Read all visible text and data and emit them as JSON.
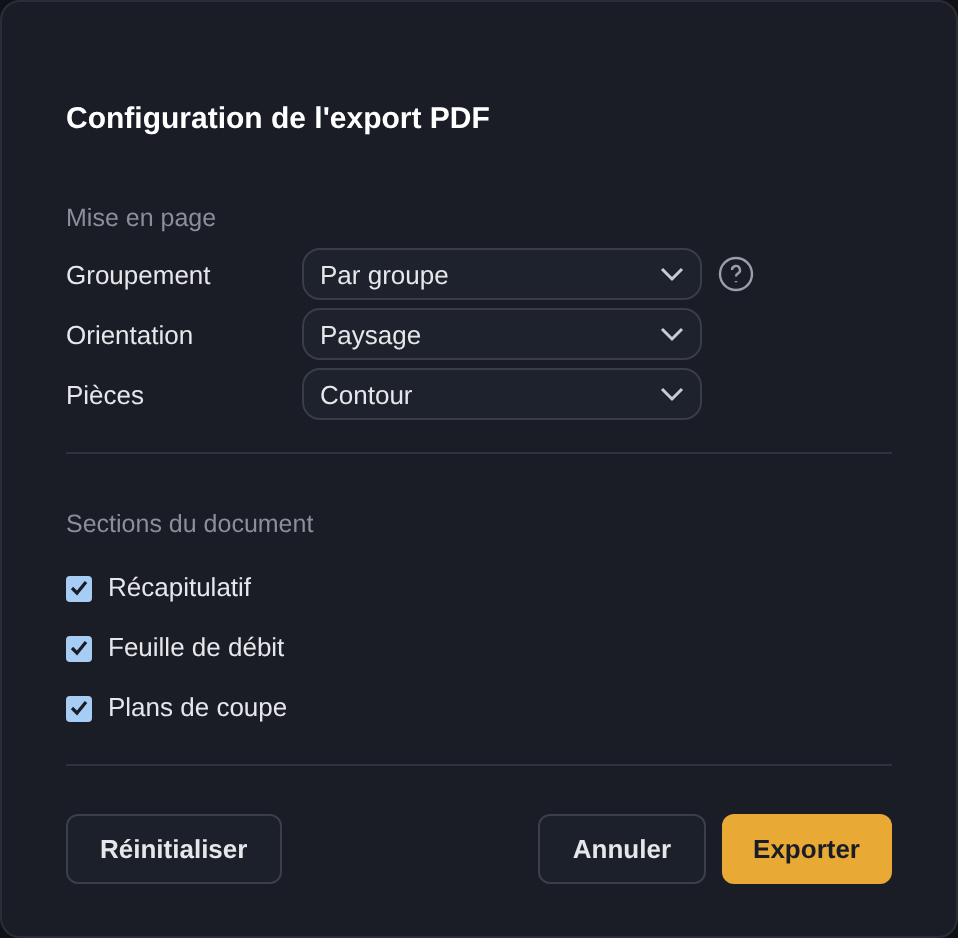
{
  "dialog": {
    "title": "Configuration de l'export PDF"
  },
  "layout_section": {
    "heading": "Mise en page",
    "fields": [
      {
        "label": "Groupement",
        "value": "Par groupe",
        "help": true
      },
      {
        "label": "Orientation",
        "value": "Paysage",
        "help": false
      },
      {
        "label": "Pièces",
        "value": "Contour",
        "help": false
      }
    ]
  },
  "sections": {
    "heading": "Sections du document",
    "items": [
      {
        "label": "Récapitulatif",
        "checked": true
      },
      {
        "label": "Feuille de débit",
        "checked": true
      },
      {
        "label": "Plans de coupe",
        "checked": true
      }
    ]
  },
  "buttons": [
    {
      "label": "Réinitialiser",
      "kind": "secondary"
    },
    {
      "label": "Annuler",
      "kind": "secondary"
    },
    {
      "label": "Exporter",
      "kind": "primary"
    }
  ]
}
